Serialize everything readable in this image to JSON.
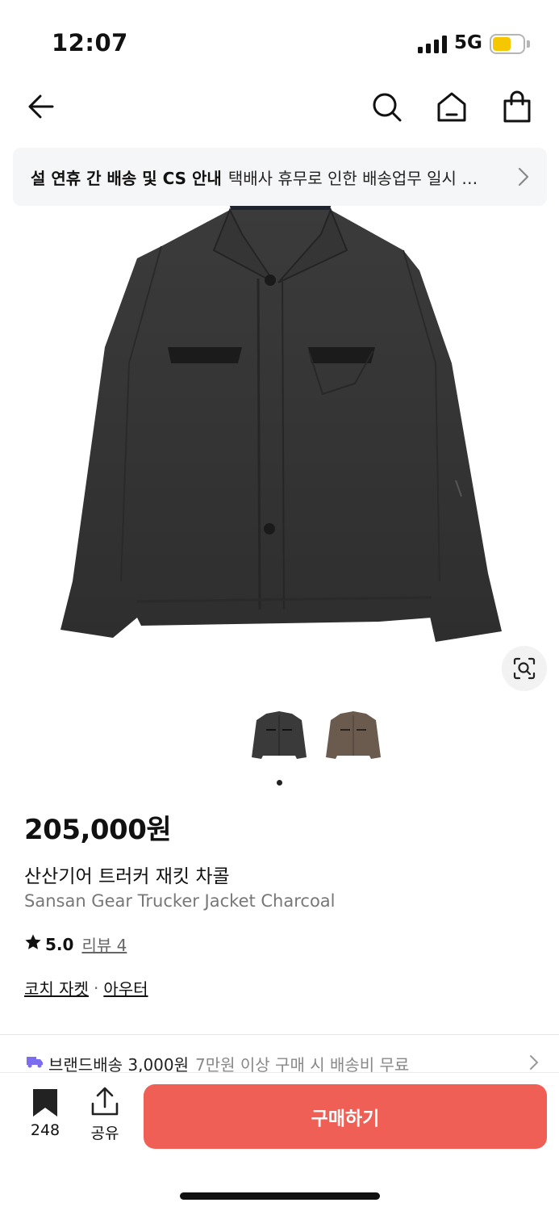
{
  "status_bar": {
    "time": "12:07",
    "network": "5G",
    "battery_color": "#f6c700"
  },
  "nav": {
    "back_icon": "arrow-left-icon",
    "search_icon": "search-icon",
    "home_icon": "home-icon",
    "cart_icon": "shopping-bag-icon"
  },
  "notice": {
    "title": "설 연휴 간 배송 및 CS 안내",
    "text": "택배사 휴무로 인한 배송업무 일시 중단 안내"
  },
  "gallery": {
    "thumbnails": [
      {
        "color_name": "charcoal",
        "color": "#3a3a3a"
      },
      {
        "color_name": "brown",
        "color": "#6b5a4e"
      }
    ],
    "active_index": 0,
    "lens_icon": "image-search-icon"
  },
  "product": {
    "price": "205,000원",
    "name_ko": "산산기어 트러커 재킷 차콜",
    "name_en": "Sansan Gear Trucker Jacket Charcoal",
    "rating": "5.0",
    "review_label": "리뷰 4",
    "categories": [
      "코치 자켓",
      "아우터"
    ]
  },
  "shipping": {
    "label": "브랜드배송 3,000원",
    "note": "7만원 이상 구매 시 배송비 무료"
  },
  "bottom_bar": {
    "save_count": "248",
    "share_label": "공유",
    "buy_label": "구매하기",
    "buy_color": "#ef5f55"
  }
}
